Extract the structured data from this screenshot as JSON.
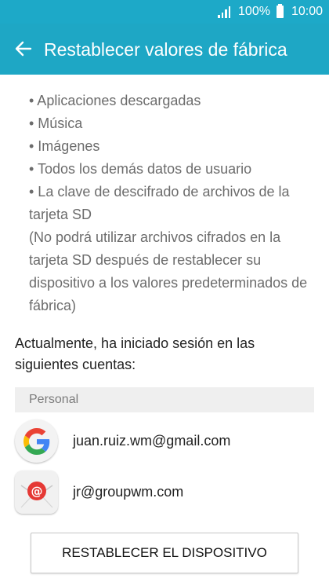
{
  "status_bar": {
    "battery": "100%",
    "time": "10:00"
  },
  "header": {
    "title": "Restablecer valores de fábrica"
  },
  "data_list": [
    "• Aplicaciones descargadas",
    "• Música",
    "• Imágenes",
    "• Todos los demás datos de usuario",
    "• La clave de descifrado de archivos de la tarjeta SD"
  ],
  "sd_note": "(No podrá utilizar archivos cifrados en la tarjeta SD después de restablecer su dispositivo a los valores predeterminados de fábrica)",
  "accounts_intro": "Actualmente, ha iniciado sesión en las siguientes cuentas:",
  "accounts_section": {
    "header": "Personal",
    "items": [
      {
        "icon": "google-icon",
        "email": "juan.ruiz.wm@gmail.com"
      },
      {
        "icon": "email-app-icon",
        "email": "jr@groupwm.com"
      }
    ]
  },
  "reset_button": {
    "label": "RESTABLECER EL DISPOSITIVO"
  },
  "colors": {
    "app_bar": "#1ea7c5",
    "status_bar": "#1da9c8",
    "secondary_text": "#6c6c6c",
    "primary_text": "#222222",
    "section_header_bg": "#efefef",
    "email_icon_red": "#e53935"
  }
}
